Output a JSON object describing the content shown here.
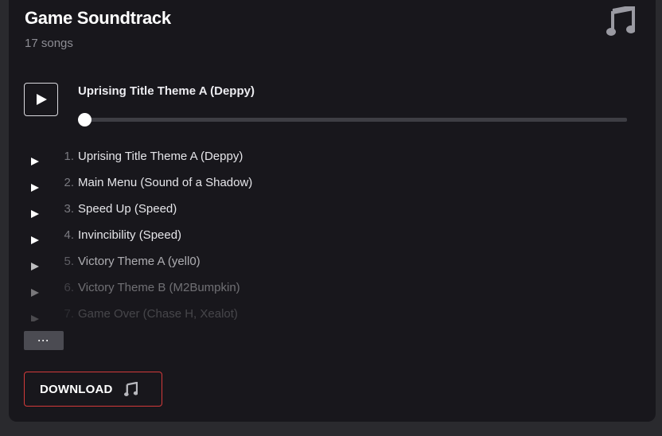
{
  "header": {
    "title": "Game Soundtrack",
    "song_count": "17 songs",
    "corner_icon": "music-note-icon"
  },
  "player": {
    "now_playing": "Uprising Title Theme A (Deppy)",
    "progress_fraction": 0.0
  },
  "tracks": [
    {
      "num": "1.",
      "name": "Uprising Title Theme A (Deppy)"
    },
    {
      "num": "2.",
      "name": "Main Menu (Sound of a Shadow)"
    },
    {
      "num": "3.",
      "name": "Speed Up (Speed)"
    },
    {
      "num": "4.",
      "name": "Invincibility (Speed)"
    },
    {
      "num": "5.",
      "name": "Victory Theme A (yell0)"
    },
    {
      "num": "6.",
      "name": "Victory Theme B (M2Bumpkin)"
    },
    {
      "num": "7.",
      "name": "Game Over (Chase H, Xealot)"
    }
  ],
  "actions": {
    "more_label": "···",
    "download_label": "DOWNLOAD",
    "download_icon": "music-note-icon"
  },
  "colors": {
    "background": "#2a2a2e",
    "card": "#18171c",
    "accent_border": "#d33a3a"
  }
}
